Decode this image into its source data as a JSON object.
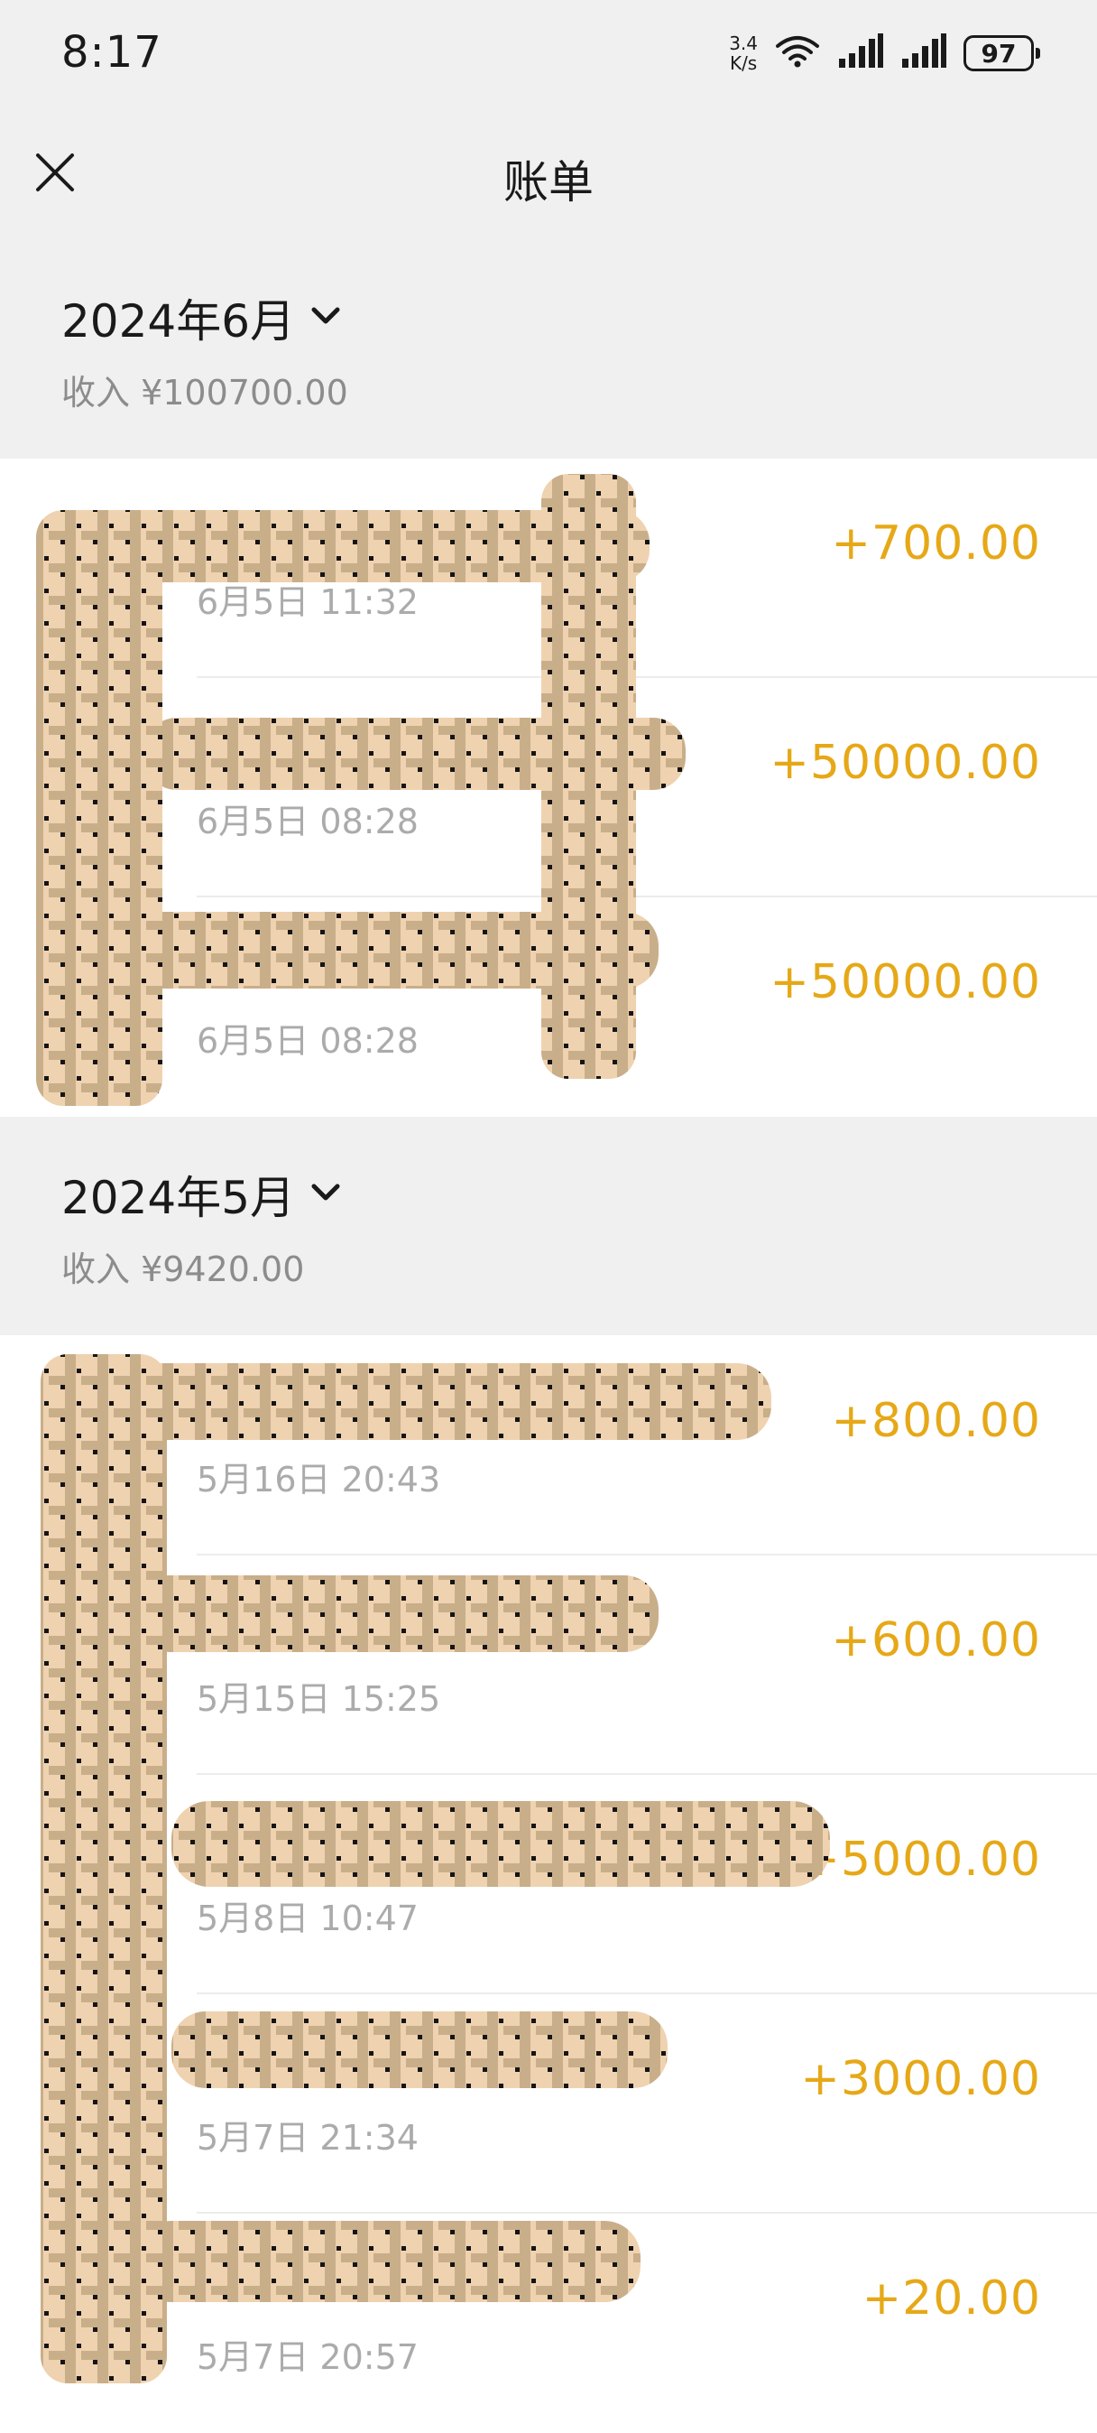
{
  "status_bar": {
    "time": "8:17",
    "net_speed_value": "3.4",
    "net_speed_unit": "K/s",
    "battery": "97"
  },
  "nav": {
    "title": "账单",
    "close_icon": "close-icon"
  },
  "months": [
    {
      "label": "2024年6月",
      "income": "收入 ¥100700.00",
      "transactions": [
        {
          "amount": "+700.00",
          "time": "6月5日 11:32"
        },
        {
          "amount": "+50000.00",
          "time": "6月5日 08:28"
        },
        {
          "amount": "+50000.00",
          "time": "6月5日 08:28"
        }
      ]
    },
    {
      "label": "2024年5月",
      "income": "收入 ¥9420.00",
      "transactions": [
        {
          "amount": "+800.00",
          "time": "5月16日 20:43"
        },
        {
          "amount": "+600.00",
          "time": "5月15日 15:25"
        },
        {
          "amount": "+5000.00",
          "time": "5月8日 10:47"
        },
        {
          "amount": "+3000.00",
          "time": "5月7日 21:34"
        },
        {
          "amount": "+20.00",
          "time": "5月7日 20:57"
        }
      ]
    }
  ],
  "colors": {
    "amount": "#e6a817",
    "header_bg": "#f0f0f0",
    "secondary_text": "#8c8c8c",
    "redaction_light": "#efd2b0",
    "redaction_dark": "#c9ae8a"
  }
}
